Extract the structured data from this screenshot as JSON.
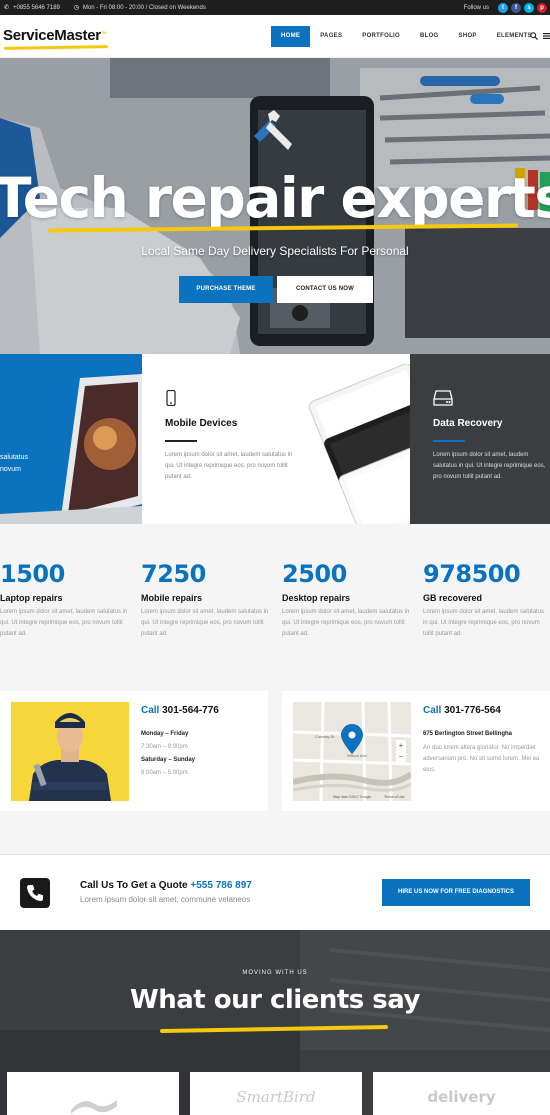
{
  "topbar": {
    "phone": "+0855 5646 7189",
    "hours": "Mon - Fri 08:00 - 20:00 / Closed on Weekends",
    "follow_label": "Follow us",
    "social": [
      {
        "icon": "twitter-icon",
        "glyph": "t",
        "color": "#1da1f2"
      },
      {
        "icon": "facebook-icon",
        "glyph": "f",
        "color": "#3b5998"
      },
      {
        "icon": "skype-icon",
        "glyph": "s",
        "color": "#00aff0"
      },
      {
        "icon": "pinterest-icon",
        "glyph": "p",
        "color": "#cb2027"
      }
    ]
  },
  "header": {
    "logo": "ServiceMaster",
    "logo_tm": "TM",
    "nav": [
      "HOME",
      "PAGES",
      "PORTFOLIO",
      "BLOG",
      "SHOP",
      "ELEMENTS"
    ],
    "active_nav": "HOME"
  },
  "hero": {
    "title": "Tech repair experts",
    "subtitle": "Local Same Day Delivery Specialists For Personal",
    "primary_button": "PURCHASE THEME",
    "secondary_button": "CONTACT US NOW"
  },
  "features": {
    "left_partial_text": [
      "salutatus",
      "novum"
    ],
    "mobile": {
      "title": "Mobile Devices",
      "text": "Lorem ipsum dolor sit amet, laudem salutatus in qui. Ut integre reprimique eos, pro novum tollit putant ad."
    },
    "data": {
      "title": "Data Recovery",
      "text": "Lorem ipsum dolor sit amet, laudem salutatus in qui. Ut integre reprimique eos, pro novum tollit putant ad."
    }
  },
  "stats": [
    {
      "number": "1500",
      "label": "Laptop repairs",
      "text": "Lorem ipsum dolor sit amet, laudem salutatus in qui. Ut integre reprimique eos, pro novum tollit putant ad."
    },
    {
      "number": "7250",
      "label": "Mobile repairs",
      "text": "Lorem ipsum dolor sit amet, laudem salutatus in qui. Ut integre reprimique eos, pro novum tollit putant ad."
    },
    {
      "number": "2500",
      "label": "Desktop repairs",
      "text": "Lorem ipsum dolor sit amet, laudem salutatus in qui. Ut integre reprimique eos, pro novum tollit putant ad."
    },
    {
      "number": "978500",
      "label": "GB recovered",
      "text": "Lorem ipsum dolor sit amet, laudem salutatus in qui. Ut integre reprimique eos, pro novum tollit putant ad."
    }
  ],
  "contact_cards": {
    "left": {
      "call_word": "Call",
      "phone": "301-564-776",
      "weekdays": "Monday – Friday",
      "weekday_hours": "7:30am – 9:00pm",
      "weekend": "Saturday – Sunday",
      "weekend_hours": "8:00am – 5:00pm"
    },
    "right": {
      "call_word": "Call",
      "phone": "301-776-564",
      "address": "675 Berlington Street Bellingha",
      "text": "An duo lorem altera gloriatur. No imperdiet adversarium pro. No sit sumo lorem. Mei ea eius.",
      "map_labels": [
        "Conway St",
        "Wilson Ave",
        "Map data ©2017 Google",
        "Terms of Use"
      ]
    }
  },
  "quote": {
    "title": "Call Us To Get a Quote",
    "phone": "+555 786 897",
    "subtitle": "Lorem ipsum dolor sit amet, commune velaneos",
    "button": "HIRE US NOW FOR FREE DIAGNOSTICS"
  },
  "testimonials": {
    "kicker": "MOVING WITH US",
    "title": "What our clients say",
    "logos": [
      "",
      "SmartBird",
      "delivery"
    ]
  },
  "colors": {
    "accent": "#0b72c0",
    "highlight": "#f6c90e",
    "dark": "#3b3d40"
  }
}
